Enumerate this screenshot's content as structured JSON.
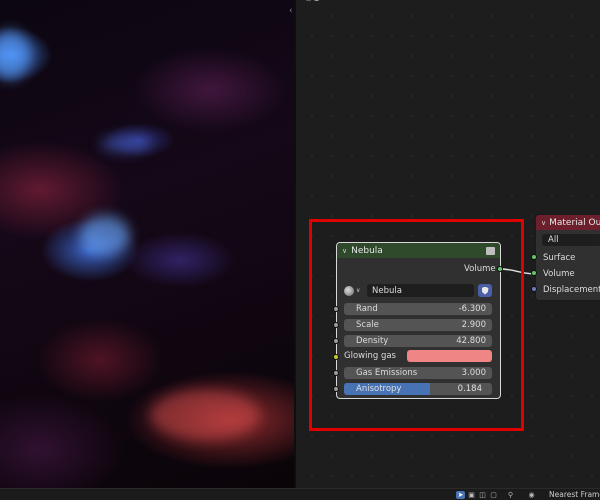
{
  "nebula_node": {
    "title": "Nebula",
    "output_label": "Volume",
    "datablock_name": "Nebula",
    "params": [
      {
        "label": "Rand",
        "value": "-6.300"
      },
      {
        "label": "Scale",
        "value": "2.900"
      },
      {
        "label": "Density",
        "value": "42.800"
      }
    ],
    "glowing_gas_label": "Glowing gas",
    "glowing_gas_color": "#f08585",
    "gas_emissions": {
      "label": "Gas Emissions",
      "value": "3.000"
    },
    "anisotropy": {
      "label": "Anisotropy",
      "value": "0.184",
      "fill_fraction": 0.58
    },
    "header_color": "#2e4a2a"
  },
  "material_output_node": {
    "title": "Material Outp",
    "target": "All",
    "inputs": [
      "Surface",
      "Volume",
      "Displacement"
    ],
    "header_color": "#6e1f2c"
  },
  "highlight_color": "#e00000",
  "status_bar": {
    "playback_mode": "Nearest Frame"
  }
}
